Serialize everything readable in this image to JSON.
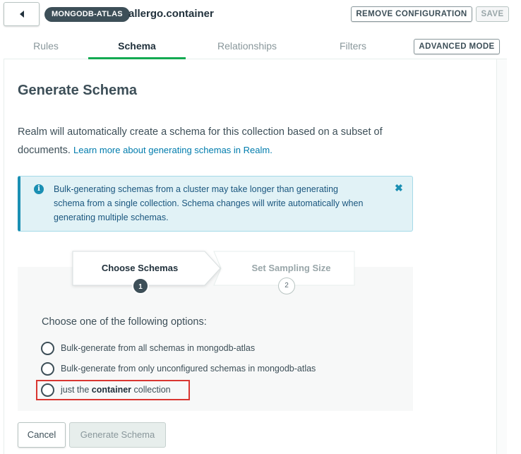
{
  "header": {
    "service_badge": "MONGODB-ATLAS",
    "collection_name": "allergo.container",
    "remove_config_label": "REMOVE CONFIGURATION",
    "save_label": "SAVE"
  },
  "tabs": [
    {
      "label": "Rules",
      "active": false
    },
    {
      "label": "Schema",
      "active": true
    },
    {
      "label": "Relationships",
      "active": false
    },
    {
      "label": "Filters",
      "active": false
    }
  ],
  "advanced_mode_label": "ADVANCED MODE",
  "main": {
    "title": "Generate Schema",
    "description": "Realm will automatically create a schema for this collection based on a subset of documents.",
    "learn_more_link": "Learn more about generating schemas in Realm.",
    "info_banner": {
      "text": "Bulk-generating schemas from a cluster may take longer than generating schema from a single collection. Schema changes will write automatically when generating multiple schemas."
    },
    "wizard": {
      "steps": [
        {
          "label": "Choose Schemas",
          "number": "1",
          "active": true
        },
        {
          "label": "Set Sampling Size",
          "number": "2",
          "active": false
        }
      ],
      "prompt": "Choose one of the following options:",
      "options": [
        {
          "label": "Bulk-generate from all schemas in mongodb-atlas"
        },
        {
          "label": "Bulk-generate from only unconfigured schemas in mongodb-atlas"
        },
        {
          "prefix": "just the ",
          "bold": "container",
          "suffix": " collection"
        }
      ]
    },
    "cancel_label": "Cancel",
    "generate_label": "Generate Schema"
  },
  "colors": {
    "accent_green": "#13aa52",
    "info_blue": "#1a8fb3",
    "highlight_red": "#d93631"
  }
}
